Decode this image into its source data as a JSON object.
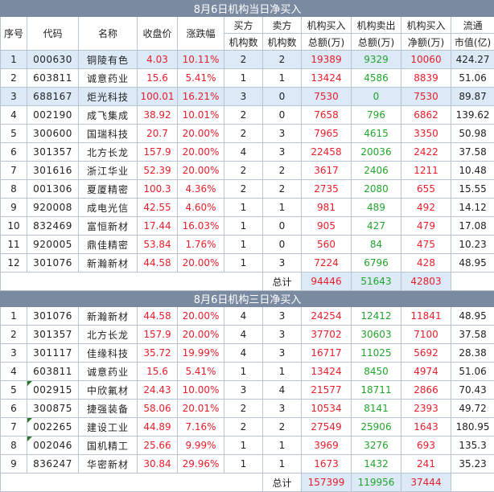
{
  "table1": {
    "title": "8月6日机构当日净买入",
    "headers": {
      "idx": "序号",
      "code": "代码",
      "name": "名称",
      "close": "收盘价",
      "chg": "涨跌幅",
      "buyers_top": "买方",
      "buyers_bot": "机构数",
      "sellers_top": "卖方",
      "sellers_bot": "机构数",
      "buy_top": "机构买入",
      "buy_bot": "总额(万)",
      "sell_top": "机构卖出",
      "sell_bot": "总额(万)",
      "net_top": "机构买入",
      "net_bot": "净额(万)",
      "cap_top": "流通",
      "cap_bot": "市值(亿)"
    },
    "rows": [
      {
        "idx": "1",
        "code": "000630",
        "name": "铜陵有色",
        "close": "4.03",
        "chg": "10.11%",
        "b": "2",
        "s": "2",
        "buy": "19389",
        "sell": "9329",
        "net": "10060",
        "cap": "424.27",
        "hl": true
      },
      {
        "idx": "2",
        "code": "603811",
        "name": "诚意药业",
        "close": "15.6",
        "chg": "5.41%",
        "b": "1",
        "s": "1",
        "buy": "13424",
        "sell": "4586",
        "net": "8839",
        "cap": "51.06",
        "hl": false
      },
      {
        "idx": "3",
        "code": "688167",
        "name": "炬光科技",
        "close": "100.01",
        "chg": "16.21%",
        "b": "3",
        "s": "0",
        "buy": "7530",
        "sell": "0",
        "net": "7530",
        "cap": "89.87",
        "hl": true
      },
      {
        "idx": "4",
        "code": "002190",
        "name": "成飞集成",
        "close": "38.92",
        "chg": "10.01%",
        "b": "2",
        "s": "0",
        "buy": "7658",
        "sell": "796",
        "net": "6862",
        "cap": "139.62",
        "hl": false
      },
      {
        "idx": "5",
        "code": "300600",
        "name": "国瑞科技",
        "close": "20.7",
        "chg": "20.00%",
        "b": "2",
        "s": "3",
        "buy": "7965",
        "sell": "4615",
        "net": "3350",
        "cap": "50.98",
        "hl": false
      },
      {
        "idx": "6",
        "code": "301357",
        "name": "北方长龙",
        "close": "157.9",
        "chg": "20.00%",
        "b": "4",
        "s": "3",
        "buy": "22458",
        "sell": "20036",
        "net": "2422",
        "cap": "37.58",
        "hl": false
      },
      {
        "idx": "7",
        "code": "301616",
        "name": "浙江华业",
        "close": "52.39",
        "chg": "20.00%",
        "b": "2",
        "s": "2",
        "buy": "3617",
        "sell": "2406",
        "net": "1211",
        "cap": "10.48",
        "hl": false
      },
      {
        "idx": "8",
        "code": "001306",
        "name": "夏厦精密",
        "close": "100.3",
        "chg": "4.36%",
        "b": "2",
        "s": "2",
        "buy": "2735",
        "sell": "2080",
        "net": "655",
        "cap": "15.55",
        "hl": false
      },
      {
        "idx": "9",
        "code": "920008",
        "name": "成电光信",
        "close": "42.55",
        "chg": "4.60%",
        "b": "1",
        "s": "1",
        "buy": "981",
        "sell": "489",
        "net": "492",
        "cap": "14.12",
        "hl": false
      },
      {
        "idx": "10",
        "code": "832469",
        "name": "富恒新材",
        "close": "17.44",
        "chg": "16.03%",
        "b": "1",
        "s": "0",
        "buy": "905",
        "sell": "427",
        "net": "479",
        "cap": "17.08",
        "hl": false
      },
      {
        "idx": "11",
        "code": "920005",
        "name": "鼎佳精密",
        "close": "53.84",
        "chg": "1.76%",
        "b": "1",
        "s": "0",
        "buy": "560",
        "sell": "84",
        "net": "475",
        "cap": "10.23",
        "hl": false
      },
      {
        "idx": "12",
        "code": "301076",
        "name": "新瀚新材",
        "close": "44.58",
        "chg": "20.00%",
        "b": "1",
        "s": "3",
        "buy": "7224",
        "sell": "6796",
        "net": "428",
        "cap": "48.95",
        "hl": false
      }
    ],
    "total_label": "总计",
    "total_buy": "94446",
    "total_sell": "51643",
    "total_net": "42803"
  },
  "table2": {
    "title": "8月6日机构三日净买入",
    "rows": [
      {
        "idx": "1",
        "code": "301076",
        "name": "新瀚新材",
        "close": "44.58",
        "chg": "20.00%",
        "b": "4",
        "s": "3",
        "buy": "24254",
        "sell": "12412",
        "net": "11841",
        "cap": "48.95",
        "tri": false
      },
      {
        "idx": "2",
        "code": "301357",
        "name": "北方长龙",
        "close": "157.9",
        "chg": "20.00%",
        "b": "4",
        "s": "3",
        "buy": "37702",
        "sell": "30603",
        "net": "7100",
        "cap": "37.58",
        "tri": false
      },
      {
        "idx": "3",
        "code": "301117",
        "name": "佳缘科技",
        "close": "35.72",
        "chg": "19.99%",
        "b": "4",
        "s": "3",
        "buy": "16717",
        "sell": "11025",
        "net": "5692",
        "cap": "28.38",
        "tri": false
      },
      {
        "idx": "4",
        "code": "603811",
        "name": "诚意药业",
        "close": "15.6",
        "chg": "5.41%",
        "b": "1",
        "s": "1",
        "buy": "13424",
        "sell": "8450",
        "net": "4974",
        "cap": "51.06",
        "tri": false
      },
      {
        "idx": "5",
        "code": "002915",
        "name": "中欣氟材",
        "close": "24.43",
        "chg": "10.00%",
        "b": "3",
        "s": "4",
        "buy": "21577",
        "sell": "18711",
        "net": "2866",
        "cap": "70.43",
        "tri": true
      },
      {
        "idx": "6",
        "code": "300875",
        "name": "捷强装备",
        "close": "58.06",
        "chg": "20.01%",
        "b": "2",
        "s": "3",
        "buy": "10534",
        "sell": "8141",
        "net": "2393",
        "cap": "49.72",
        "tri": false
      },
      {
        "idx": "7",
        "code": "002265",
        "name": "建设工业",
        "close": "44.89",
        "chg": "7.16%",
        "b": "2",
        "s": "2",
        "buy": "27549",
        "sell": "25906",
        "net": "1643",
        "cap": "180.95",
        "tri": true
      },
      {
        "idx": "8",
        "code": "002046",
        "name": "国机精工",
        "close": "25.66",
        "chg": "9.99%",
        "b": "1",
        "s": "1",
        "buy": "3969",
        "sell": "3276",
        "net": "693",
        "cap": "135.3",
        "tri": true
      },
      {
        "idx": "9",
        "code": "836247",
        "name": "华密新材",
        "close": "30.84",
        "chg": "29.96%",
        "b": "1",
        "s": "1",
        "buy": "1673",
        "sell": "1432",
        "net": "241",
        "cap": "35.23",
        "tri": false
      }
    ],
    "total_label": "总计",
    "total_buy": "157399",
    "total_sell": "119956",
    "total_net": "37444"
  }
}
